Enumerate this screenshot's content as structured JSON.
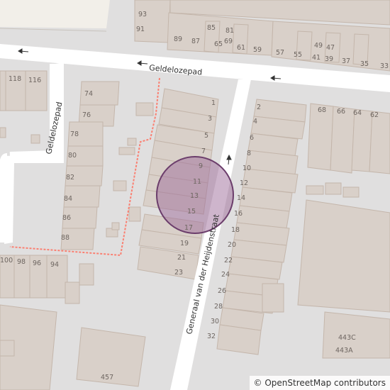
{
  "map": {
    "colors": {
      "background": "#e0dfdf",
      "building": "#d9d0c9",
      "building_outline": "#c4b6ab",
      "road": "#ffffff",
      "footpath": "#fa8072",
      "marker_fill": "#9d6b9a",
      "marker_stroke": "#6b3d6b"
    },
    "streets": {
      "geldelozepad_h": "Geldelozepad",
      "geldelozepad_v": "Geldelozepad",
      "generaal": "Generaal van der Heijdenstraat"
    },
    "house_numbers": [
      "93",
      "91",
      "85",
      "81",
      "89",
      "87",
      "65",
      "69",
      "61",
      "59",
      "57",
      "55",
      "49",
      "47",
      "41",
      "39",
      "37",
      "35",
      "33",
      "118",
      "116",
      "74",
      "76",
      "78",
      "80",
      "82",
      "84",
      "86",
      "88",
      "1",
      "3",
      "5",
      "7",
      "9",
      "11",
      "13",
      "15",
      "17",
      "19",
      "21",
      "23",
      "2",
      "4",
      "6",
      "8",
      "10",
      "12",
      "14",
      "16",
      "18",
      "20",
      "22",
      "24",
      "26",
      "28",
      "30",
      "32",
      "68",
      "66",
      "64",
      "62",
      "100",
      "98",
      "96",
      "94",
      "443C",
      "443A",
      "457"
    ],
    "attribution": "© OpenStreetMap contributors"
  }
}
